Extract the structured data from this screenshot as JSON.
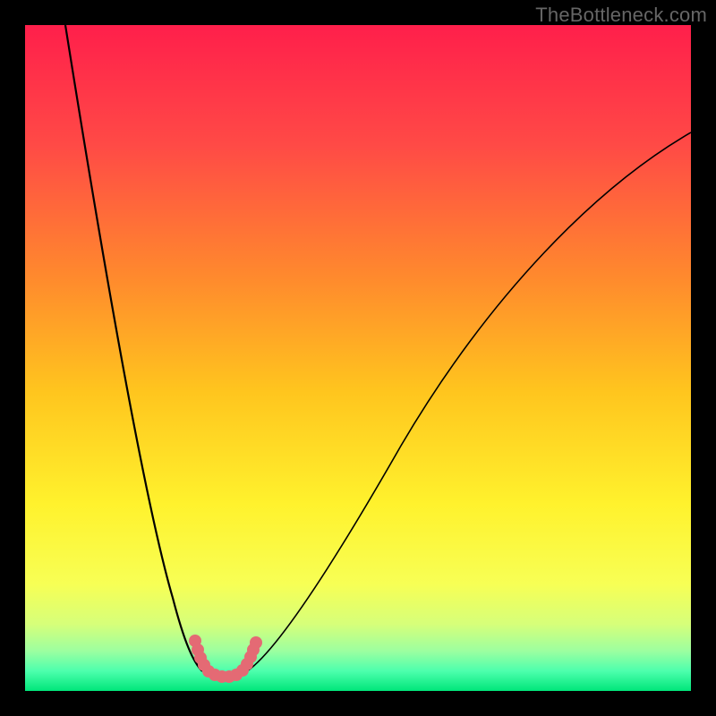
{
  "watermark": "TheBottleneck.com",
  "chart_data": {
    "type": "line",
    "title": "",
    "xlabel": "",
    "ylabel": "",
    "xlim": [
      0,
      100
    ],
    "ylim": [
      0,
      100
    ],
    "grid": false,
    "legend": false,
    "background_gradient": {
      "orientation": "vertical",
      "stops": [
        {
          "pos": 0.0,
          "color": "#ff1f4b"
        },
        {
          "pos": 0.18,
          "color": "#ff4a46"
        },
        {
          "pos": 0.38,
          "color": "#ff8a2d"
        },
        {
          "pos": 0.55,
          "color": "#ffc51e"
        },
        {
          "pos": 0.72,
          "color": "#fff22d"
        },
        {
          "pos": 0.84,
          "color": "#f7ff55"
        },
        {
          "pos": 0.9,
          "color": "#d6ff7a"
        },
        {
          "pos": 0.94,
          "color": "#9cffa0"
        },
        {
          "pos": 0.97,
          "color": "#4dffad"
        },
        {
          "pos": 1.0,
          "color": "#00e67a"
        }
      ]
    },
    "series": [
      {
        "name": "bottleneck-curve",
        "color": "#000000",
        "x": [
          6,
          10,
          14,
          18,
          22,
          25,
          27,
          29,
          30,
          31,
          33,
          36,
          40,
          46,
          54,
          64,
          76,
          90,
          100
        ],
        "y": [
          100,
          76,
          52,
          32,
          16,
          8,
          4,
          2,
          1,
          2,
          4,
          8,
          16,
          28,
          42,
          56,
          68,
          78,
          84
        ]
      }
    ],
    "markers": {
      "name": "optimal-range",
      "color": "#e46a74",
      "shape": "circle",
      "x": [
        25.5,
        26.0,
        26.4,
        27.0,
        27.6,
        28.5,
        29.5,
        30.5,
        31.7,
        32.6,
        33.4,
        33.9,
        34.3,
        34.7
      ],
      "y": [
        7.5,
        6.2,
        5.0,
        4.0,
        3.0,
        2.4,
        2.2,
        2.2,
        2.4,
        3.0,
        4.0,
        5.0,
        6.2,
        7.3
      ]
    }
  }
}
